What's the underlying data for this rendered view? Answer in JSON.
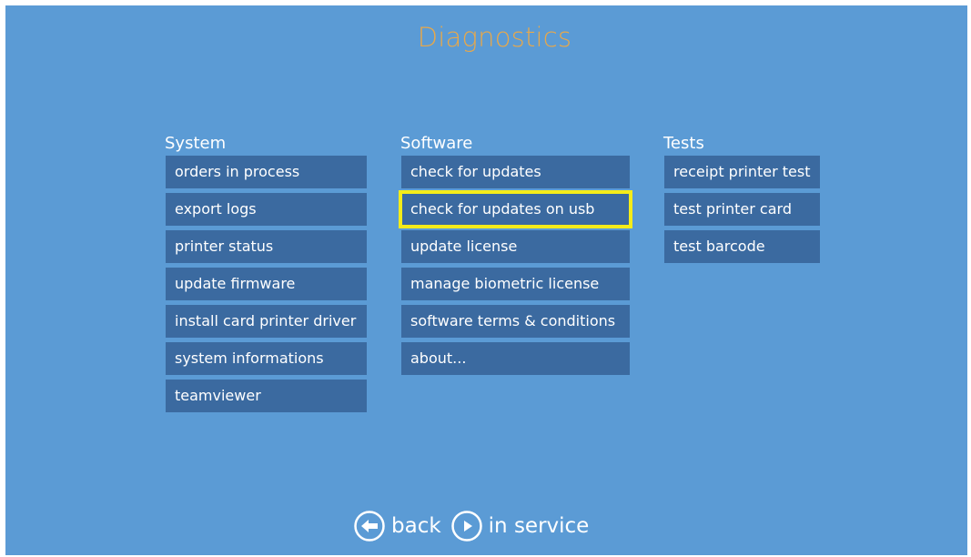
{
  "screen": {
    "title": "Diagnostics"
  },
  "columns": {
    "system": {
      "heading": "System",
      "items": [
        "orders in process",
        "export logs",
        "printer status",
        "update firmware",
        "install card printer driver",
        "system informations",
        "teamviewer"
      ]
    },
    "software": {
      "heading": "Software",
      "items": [
        "check for updates",
        "check for updates on usb",
        "update license",
        "manage biometric license",
        "software terms & conditions",
        "about..."
      ],
      "selected_index": 1
    },
    "tests": {
      "heading": "Tests",
      "items": [
        "receipt printer test",
        "test printer card",
        "test barcode"
      ]
    }
  },
  "footer": {
    "back_label": "back",
    "back_icon": "arrow-left-circle-icon",
    "in_service_label": "in service",
    "in_service_icon": "play-circle-icon"
  },
  "colors": {
    "background": "#5b9bd5",
    "tile": "#3b6aa0",
    "title": "#e8a84a",
    "selection_outline": "#f4ec1a",
    "text": "#ffffff"
  }
}
